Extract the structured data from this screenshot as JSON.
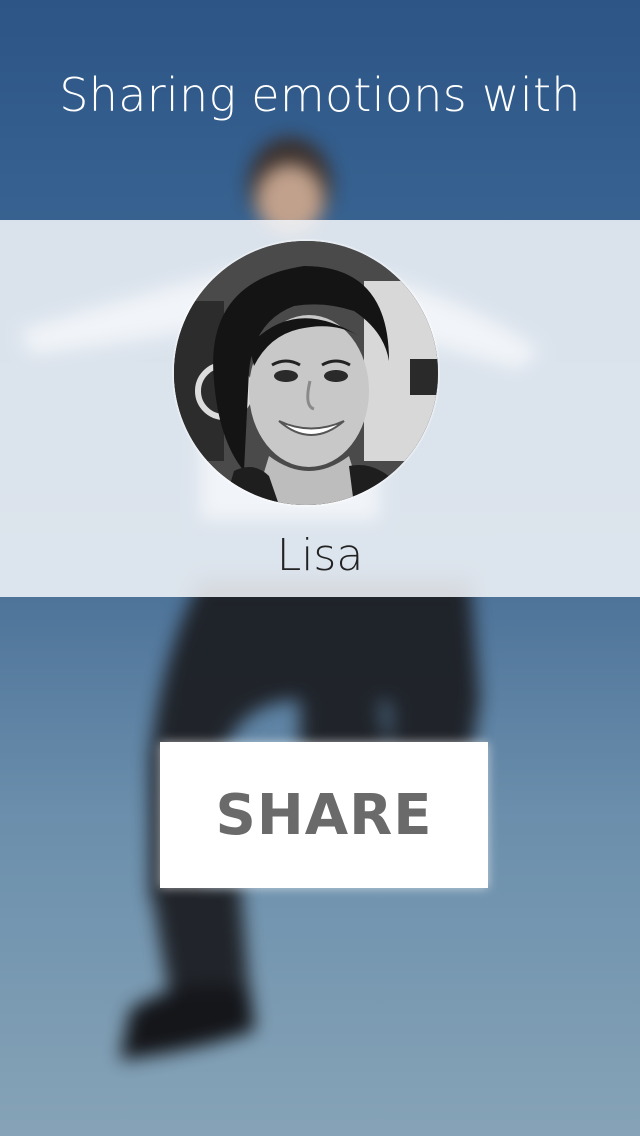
{
  "header": {
    "title": "Sharing emotions with"
  },
  "contact": {
    "name": "Lisa",
    "avatar_icon": "user-photo-avatar"
  },
  "actions": {
    "share_label": "SHARE"
  },
  "colors": {
    "sky_top": "#2d5586",
    "sky_bottom": "#86a3b7",
    "band": "#f0f4f8",
    "button_bg": "#ffffff",
    "button_text": "#6a6a6a",
    "title_text": "#ffffff",
    "name_text": "#222222"
  }
}
